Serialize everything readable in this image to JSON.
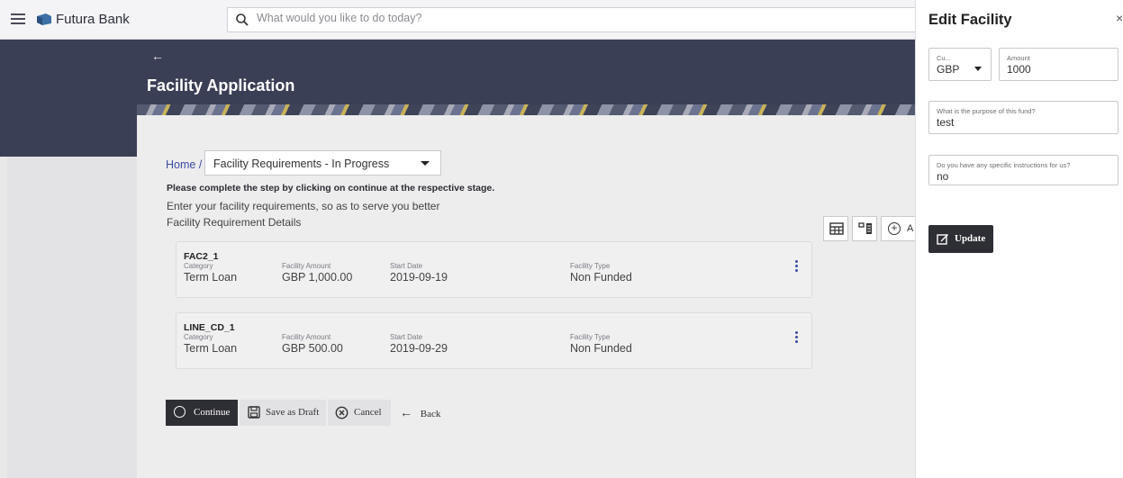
{
  "app": {
    "brand": "Futura Bank",
    "search_placeholder": "What would you like to do today?"
  },
  "header": {
    "page_title": "Facility Application"
  },
  "breadcrumb": {
    "home": "Home /",
    "selected_step": "Facility Requirements - In Progress"
  },
  "content": {
    "instruction": "Please complete the step by clicking on continue at the respective stage.",
    "intro": "Enter your facility requirements, so as to serve you better",
    "section_title": "Facility Requirement Details",
    "add_label": "A"
  },
  "facilities": [
    {
      "id": "FAC2_1",
      "category_label": "Category",
      "category": "Term Loan",
      "amount_label": "Facility Amount",
      "amount": "GBP 1,000.00",
      "start_label": "Start Date",
      "start": "2019-09-19",
      "type_label": "Facility Type",
      "type": "Non Funded"
    },
    {
      "id": "LINE_CD_1",
      "category_label": "Category",
      "category": "Term Loan",
      "amount_label": "Facility Amount",
      "amount": "GBP 500.00",
      "start_label": "Start Date",
      "start": "2019-09-29",
      "type_label": "Facility Type",
      "type": "Non Funded"
    }
  ],
  "actions": {
    "continue": "Continue",
    "save_draft": "Save as Draft",
    "cancel": "Cancel",
    "back": "Back"
  },
  "panel": {
    "title": "Edit Facility",
    "close": "×",
    "currency_label": "Cu...",
    "currency_value": "GBP",
    "amount_label": "Amount",
    "amount_value": "1000",
    "purpose_label": "What is the purpose of this fund?",
    "purpose_value": "test",
    "instructions_label": "Do you have any specific instructions for us?",
    "instructions_value": "no",
    "update": "Update"
  },
  "colors": {
    "header_band": "#3b3f55",
    "primary_button": "#2e2e35",
    "link": "#3b4ba0"
  }
}
